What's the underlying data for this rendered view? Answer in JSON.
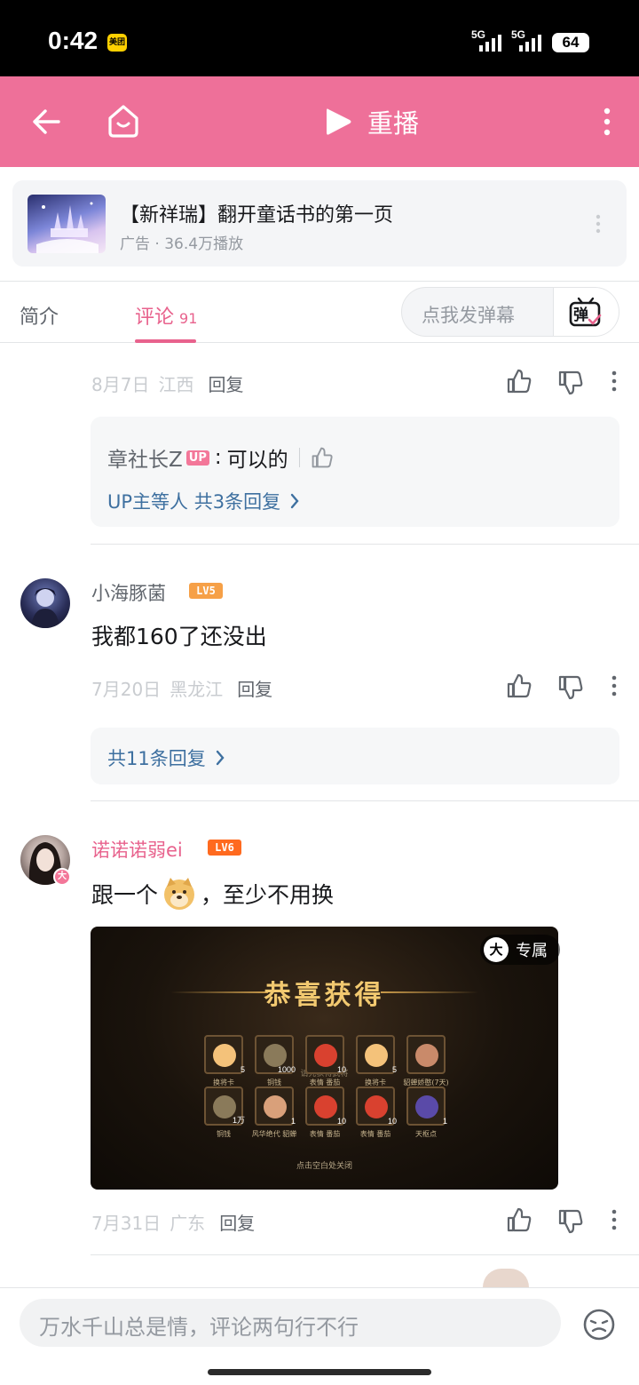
{
  "status_bar": {
    "time": "0:42",
    "app_badge": "美团",
    "signal_1": "5G",
    "signal_2": "5G",
    "battery": "64"
  },
  "header": {
    "replay_label": "重播",
    "icons": [
      "back-arrow-icon",
      "home-icon",
      "play-icon",
      "more-vertical-icon"
    ],
    "bg_color": "#ee7099"
  },
  "ad": {
    "title": "【新祥瑞】翻开童话书的第一页",
    "meta": "广告 · 36.4万播放"
  },
  "tabs": {
    "intro": "简介",
    "comments": "评论",
    "comments_count": "91",
    "danmaku_placeholder": "点我发弹幕",
    "danmaku_icon_text": "弹"
  },
  "comment_top": {
    "date": "8月7日",
    "location": "江西",
    "reply": "回复",
    "sub_reply": {
      "user": "章社长Z",
      "badge": "UP",
      "sep": ":",
      "text": "可以的"
    },
    "more_link": "UP主等人 共3条回复"
  },
  "comment_1": {
    "user": "小海豚菌",
    "level": "LV5",
    "text": "我都160了还没出",
    "date": "7月20日",
    "location": "黑龙江",
    "reply": "回复",
    "more_link": "共11条回复"
  },
  "comment_2": {
    "user": "诺诺诺弱ei",
    "level": "LV6",
    "avatar_badge": "大",
    "text_before": "跟一个",
    "text_after": "，至少不用换",
    "date": "7月31日",
    "location": "广东",
    "reply": "回复",
    "image": {
      "badge_icon": "大",
      "badge_text": "专属",
      "title": "恭喜获得",
      "center_text": "请先获得武将",
      "hint": "点击空白处关闭",
      "items": [
        {
          "name": "换将卡",
          "qty": "5"
        },
        {
          "name": "铜钱",
          "qty": "1000"
        },
        {
          "name": "表情 番茄",
          "qty": "10"
        },
        {
          "name": "换将卡",
          "qty": "5"
        },
        {
          "name": "貂蝉娇憨(7天)",
          "qty": ""
        },
        {
          "name": "铜钱",
          "qty": "1万"
        },
        {
          "name": "风华绝代 貂蝉",
          "qty": "1"
        },
        {
          "name": "表情 番茄",
          "qty": "10"
        },
        {
          "name": "表情 番茄",
          "qty": "10"
        },
        {
          "name": "天枢点",
          "qty": "1"
        }
      ]
    }
  },
  "bottom": {
    "placeholder": "万水千山总是情，评论两句行不行"
  },
  "colors": {
    "pink": "#ee7099",
    "pink_text": "#e8628d",
    "link_blue": "#3e70a0",
    "lv5": "#f6a047",
    "lv6": "#ff6a1f"
  }
}
